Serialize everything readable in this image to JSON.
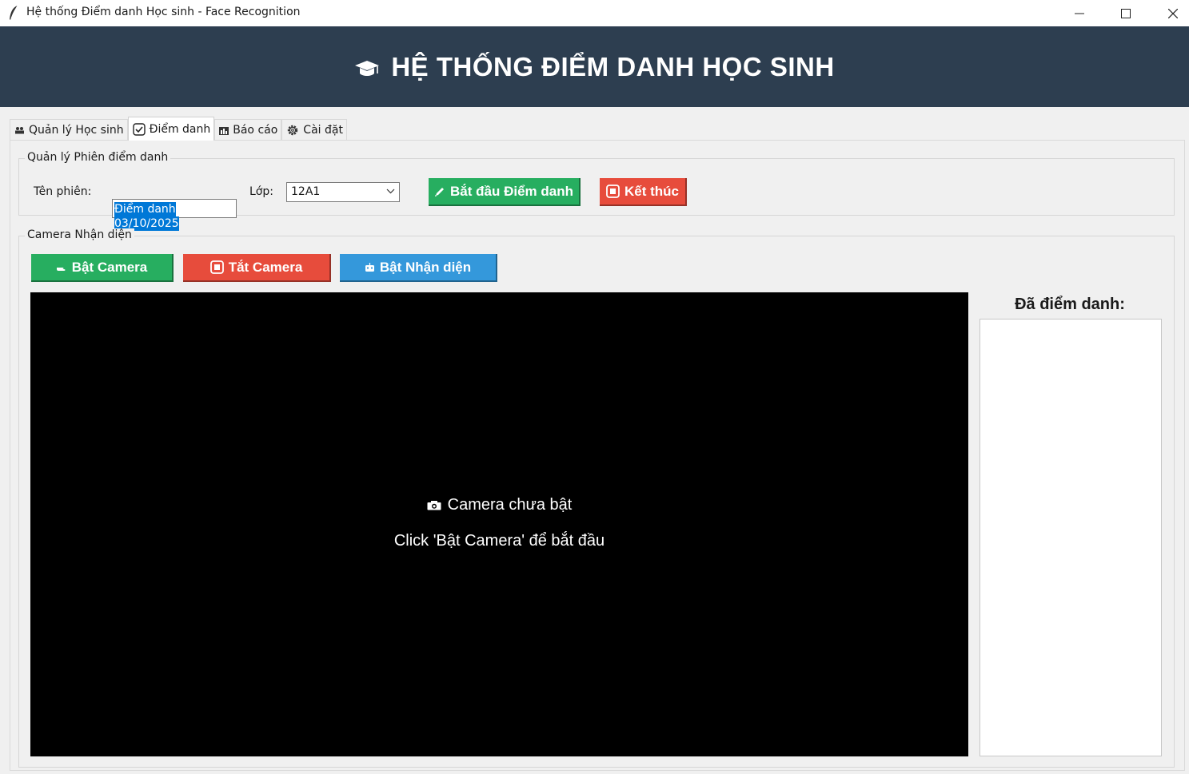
{
  "window": {
    "title": "Hệ thống Điểm danh Học sinh - Face Recognition"
  },
  "header": {
    "title": "HỆ THỐNG ĐIỂM DANH HỌC SINH",
    "icon": "graduation-cap-icon"
  },
  "tabs": [
    {
      "label": "Quản lý Học sinh",
      "icon": "people-icon"
    },
    {
      "label": "Điểm danh",
      "icon": "checkbox-icon",
      "active": true
    },
    {
      "label": "Báo cáo",
      "icon": "bar-chart-icon"
    },
    {
      "label": "Cài đặt",
      "icon": "gear-icon"
    }
  ],
  "session": {
    "group_title": "Quản lý Phiên điểm danh",
    "name_label": "Tên phiên:",
    "name_value": "Điểm danh 03/10/2025",
    "class_label": "Lớp:",
    "class_value": "12A1",
    "start_button": "Bắt đầu Điểm danh",
    "end_button": "Kết thúc"
  },
  "camera": {
    "group_title": "Camera Nhận diện",
    "on_button": "Bật Camera",
    "off_button": "Tắt Camera",
    "recognize_button": "Bật Nhận diện",
    "status_text": "Camera chưa bật",
    "hint_text": "Click 'Bật Camera' để bắt đầu"
  },
  "attended": {
    "title": "Đã điểm danh:"
  },
  "colors": {
    "header_bg": "#2d3e50",
    "green": "#27ae60",
    "red": "#e74c3c",
    "blue": "#3498db"
  }
}
